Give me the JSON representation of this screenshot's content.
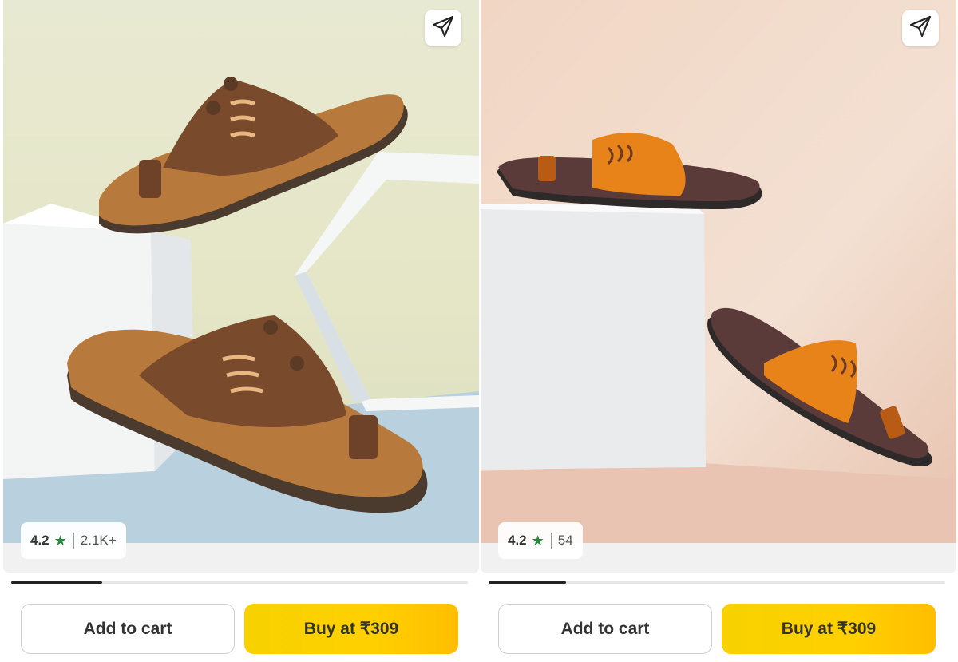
{
  "colors": {
    "buy_button": "#ffd000",
    "rating_star": "#1f8a3e",
    "progress_fill": "#222222"
  },
  "cards": [
    {
      "share_icon": "share-send-icon",
      "rating": {
        "value": "4.2",
        "star": "★",
        "count": "2.1K+"
      },
      "carousel_progress": 0.2,
      "add_to_cart_label": "Add to cart",
      "buy_label": "Buy at ₹309"
    },
    {
      "share_icon": "share-send-icon",
      "rating": {
        "value": "4.2",
        "star": "★",
        "count": "54"
      },
      "carousel_progress": 0.17,
      "add_to_cart_label": "Add to cart",
      "buy_label": "Buy at ₹309"
    }
  ]
}
